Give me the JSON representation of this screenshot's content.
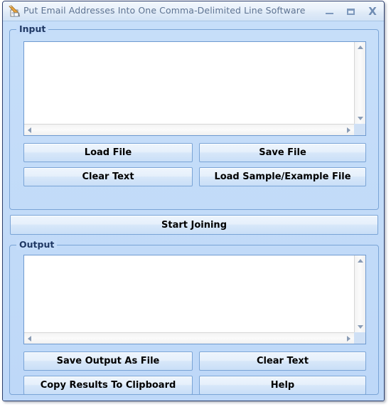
{
  "window": {
    "title": "Put Email Addresses Into One Comma-Delimited Line Software",
    "icon": "pencil-document-icon",
    "controls": {
      "minimize": "minimize-icon",
      "maximize": "maximize-icon",
      "close": "X"
    }
  },
  "input_group": {
    "label": "Input",
    "textarea": {
      "value": "",
      "placeholder": ""
    },
    "buttons": {
      "load_file": "Load File",
      "save_file": "Save File",
      "clear_text": "Clear Text",
      "load_sample": "Load Sample/Example File"
    }
  },
  "action": {
    "start_joining": "Start Joining"
  },
  "output_group": {
    "label": "Output",
    "textarea": {
      "value": "",
      "placeholder": ""
    },
    "buttons": {
      "save_output": "Save Output As File",
      "clear_text": "Clear Text",
      "copy_results": "Copy Results To Clipboard",
      "help": "Help"
    }
  },
  "colors": {
    "window_background": "#c2dbfa",
    "group_border": "#7aa4d6",
    "label_text": "#1f3864",
    "title_text": "#5d7392",
    "button_text": "#000000"
  }
}
